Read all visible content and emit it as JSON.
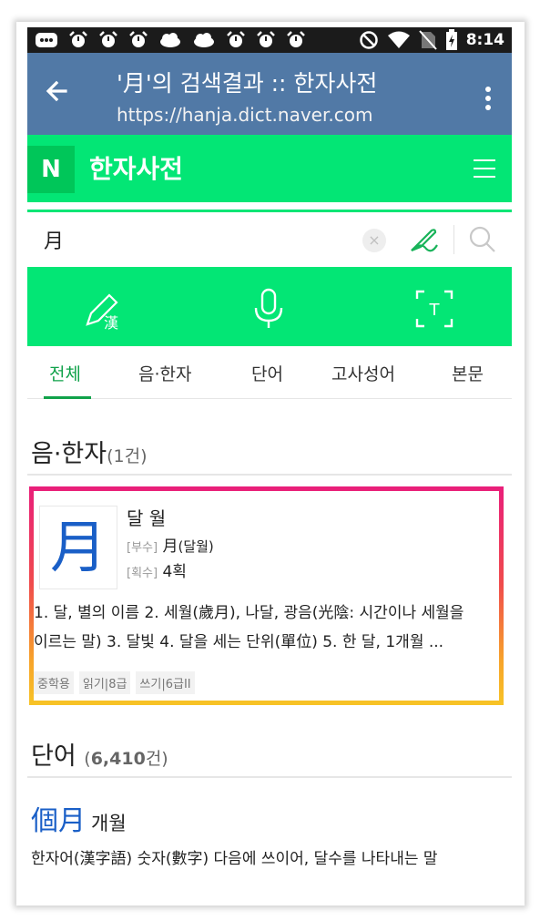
{
  "status_bar": {
    "time": "8:14",
    "icons": [
      "chat-icon",
      "alarm-icon",
      "alarm-icon",
      "alarm-icon",
      "cloud-icon",
      "cloud-icon",
      "alarm-icon",
      "alarm-icon",
      "alarm-icon",
      "do-not-disturb-icon",
      "wifi-icon",
      "no-sim-icon",
      "battery-charging-icon"
    ]
  },
  "browser": {
    "title": "'月'의 검색결과 :: 한자사전",
    "url": "https://hanja.dict.naver.com"
  },
  "header": {
    "logo": "N",
    "title": "한자사전"
  },
  "search": {
    "value": "月",
    "clear": "×"
  },
  "tabs": [
    "전체",
    "음·한자",
    "단어",
    "고사성어",
    "본문"
  ],
  "tools": {
    "handwrite_icon_char": "漢",
    "ocr_icon_char": "T"
  },
  "section_hanja": {
    "title": "음·한자",
    "count": "(1건)"
  },
  "hanja_result": {
    "char": "月",
    "reading": "달 월",
    "radical_label": "[부수]",
    "radical_value": "月",
    "radical_note": "(달월)",
    "strokes_label": "[획수]",
    "strokes_value": "4획",
    "meaning_line1": "1. 달, 별의 이름 2. 세월(歲月), 나달, 광음(光陰: 시간이나 세월을",
    "meaning_line2": "이르는 말) 3. 달빛 4. 달을 세는 단위(單位) 5. 한 달, 1개월 ...",
    "chips": [
      "중학용",
      "읽기|8급",
      "쓰기|6급II"
    ]
  },
  "section_word": {
    "title": "단어",
    "count_open": "(",
    "count_num": "6,410",
    "count_close": "건)"
  },
  "word_result": {
    "hanja": "個月",
    "reading": "개월",
    "definition": "한자어(漢字語) 숫자(數字) 다음에 쓰이어, 달수를 나타내는 말"
  },
  "colors": {
    "naver_green": "#03e675",
    "browser_bar": "#5179a6",
    "accent_blue": "#1a5fc7",
    "active_tab": "#10a24a"
  }
}
